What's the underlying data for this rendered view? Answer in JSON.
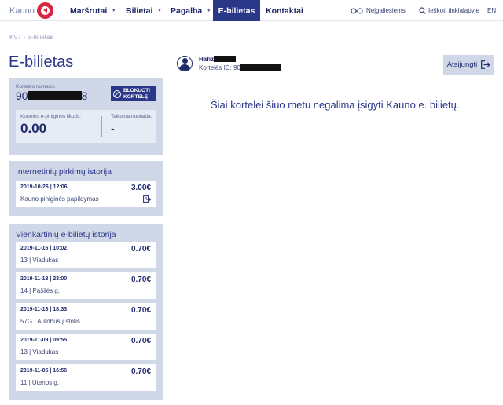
{
  "header": {
    "logo_text": "Kauno",
    "nav": [
      {
        "label": "Maršrutai",
        "dropdown": true
      },
      {
        "label": "Bilietai",
        "dropdown": true
      },
      {
        "label": "Pagalba",
        "dropdown": true
      },
      {
        "label": "E-bilietas",
        "active": true
      },
      {
        "label": "Kontaktai"
      }
    ],
    "accessibility": "Neįgaliesiems",
    "search": "Ieškoti tinklalapyje",
    "language": "EN"
  },
  "breadcrumb": "KVT › E-bilietas",
  "page_title": "E-bilietas",
  "card": {
    "number_label": "Kortelės numeris:",
    "number_prefix": "90",
    "number_suffix": "8",
    "block_button": [
      "BLOKUOTI",
      "KORTELĘ"
    ],
    "balance_label": "Kortelės e-piniginės likutis:",
    "balance_value": "0.00",
    "discount_label": "Taikoma nuolaida:",
    "discount_value": "-"
  },
  "internet_history": {
    "title": "Internetinių pirkimų istorija",
    "items": [
      {
        "date": "2019-10-26 | 12:06",
        "desc": "Kauno piniginės papildymas",
        "amount": "3.00€"
      }
    ]
  },
  "single_history": {
    "title": "Vienkartinių e-bilietų istorija",
    "items": [
      {
        "date": "2019-11-16 | 10:02",
        "desc": "13 | Viadukas",
        "amount": "0.70€"
      },
      {
        "date": "2019-11-13 | 23:00",
        "desc": "14 | Pašilės g.",
        "amount": "0.70€"
      },
      {
        "date": "2019-11-13 | 18:33",
        "desc": "57G | Autobusų stotis",
        "amount": "0.70€"
      },
      {
        "date": "2019-11-09 | 09:55",
        "desc": "13 | Viadukas",
        "amount": "0.70€"
      },
      {
        "date": "2019-11-05 | 16:56",
        "desc": "11 | Utenos g.",
        "amount": "0.70€"
      }
    ]
  },
  "user": {
    "name_prefix": "Hafiz",
    "card_label": "Kortelės ID: 90"
  },
  "logout": "Atsijungti",
  "message": "Šiai kortelei šiuo metu negalima įsigyti Kauno e. bilietų."
}
